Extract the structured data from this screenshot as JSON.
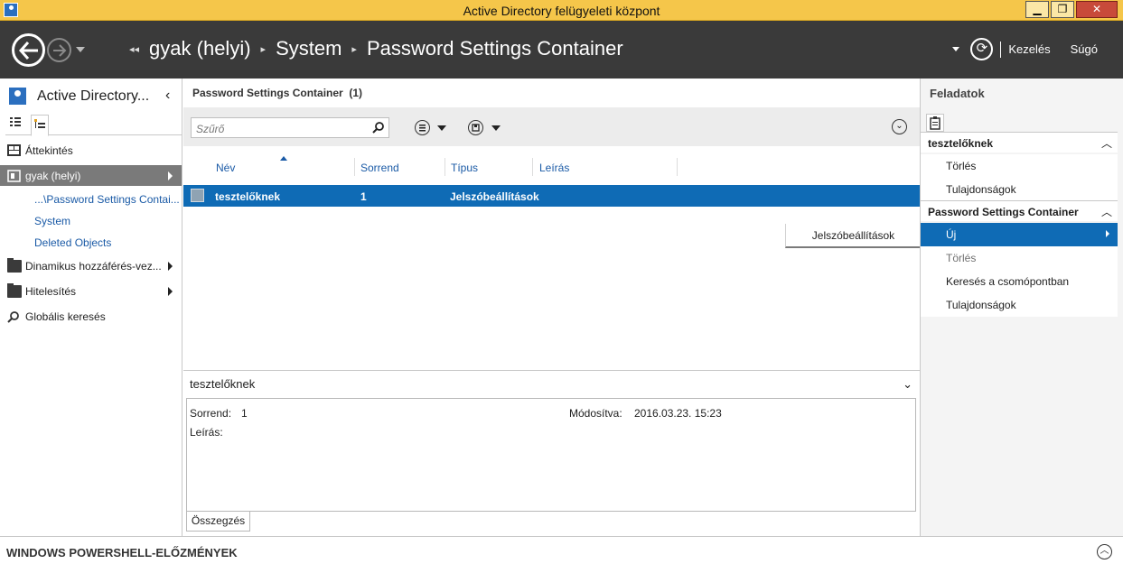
{
  "window": {
    "title": "Active Directory felügyeleti központ",
    "min": "▁",
    "max": "❐",
    "close": "✕"
  },
  "nav": {
    "breadcrumb": [
      "gyak (helyi)",
      "System",
      "Password Settings Container"
    ],
    "manage": "Kezelés",
    "help": "Súgó"
  },
  "left": {
    "title": "Active Directory...",
    "items": [
      {
        "label": "Áttekintés",
        "icon": "overview-icon"
      },
      {
        "label": "gyak (helyi)",
        "icon": "domain-icon",
        "selected": true
      },
      {
        "label": "...\\Password Settings Contai..."
      },
      {
        "label": "System"
      },
      {
        "label": "Deleted Objects"
      },
      {
        "label": "Dinamikus hozzáférés-vez...",
        "icon": "folder-icon"
      },
      {
        "label": "Hitelesítés",
        "icon": "folder-icon"
      },
      {
        "label": "Globális keresés",
        "icon": "search-icon"
      }
    ]
  },
  "center": {
    "title": "Password Settings Container",
    "count": "(1)",
    "filter_placeholder": "Szűrő",
    "columns": [
      "Név",
      "Sorrend",
      "Típus",
      "Leírás"
    ],
    "rows": [
      {
        "name": "tesztelőknek",
        "order": "1",
        "type": "Jelszóbeállítások",
        "desc": ""
      }
    ],
    "context_menu": [
      "Jelszóbeállítások"
    ]
  },
  "details": {
    "title": "tesztelőknek",
    "order_label": "Sorrend:",
    "order_value": "1",
    "modified_label": "Módosítva:",
    "modified_value": "2016.03.23. 15:23",
    "desc_label": "Leírás:",
    "tab": "Összegzés"
  },
  "tasks": {
    "title": "Feladatok",
    "section1": {
      "title": "tesztelőknek",
      "items": [
        "Törlés",
        "Tulajdonságok"
      ]
    },
    "section2": {
      "title": "Password Settings Container",
      "items": [
        "Új",
        "Törlés",
        "Keresés a csomópontban",
        "Tulajdonságok"
      ]
    }
  },
  "bottom": {
    "powershell": "WINDOWS POWERSHELL-ELŐZMÉNYEK"
  },
  "colors": {
    "titlebar": "#f5c64a",
    "navbar": "#3a3a3a",
    "selection": "#0f6bb5",
    "link": "#1a5aa6"
  }
}
